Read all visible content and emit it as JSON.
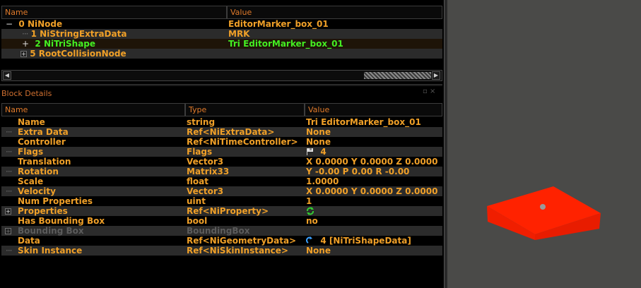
{
  "tree": {
    "col_name": "Name",
    "col_value": "Value",
    "rows": [
      {
        "name": "0 NiNode",
        "value": "EditorMarker_box_01"
      },
      {
        "name": "1 NiStringExtraData",
        "value": "MRK"
      },
      {
        "name": "2 NiTriShape",
        "value": "Tri EditorMarker_box_01"
      },
      {
        "name": "5 RootCollisionNode",
        "value": ""
      }
    ]
  },
  "details": {
    "title": "Block Details",
    "col_name": "Name",
    "col_type": "Type",
    "col_value": "Value",
    "rows": [
      {
        "name": "Name",
        "type": "string",
        "value": "Tri EditorMarker_box_01"
      },
      {
        "name": "Extra Data",
        "type": "Ref<NiExtraData>",
        "value": "None"
      },
      {
        "name": "Controller",
        "type": "Ref<NiTimeController>",
        "value": "None"
      },
      {
        "name": "Flags",
        "type": "Flags",
        "value": "4"
      },
      {
        "name": "Translation",
        "type": "Vector3",
        "value": "X 0.0000 Y 0.0000 Z 0.0000"
      },
      {
        "name": "Rotation",
        "type": "Matrix33",
        "value": "Y -0.00 P 0.00 R -0.00"
      },
      {
        "name": "Scale",
        "type": "float",
        "value": "1.0000"
      },
      {
        "name": "Velocity",
        "type": "Vector3",
        "value": "X 0.0000 Y 0.0000 Z 0.0000"
      },
      {
        "name": "Num Properties",
        "type": "uint",
        "value": "1"
      },
      {
        "name": "Properties",
        "type": "Ref<NiProperty>",
        "value": ""
      },
      {
        "name": "Has Bounding Box",
        "type": "bool",
        "value": "no"
      },
      {
        "name": "Bounding Box",
        "type": "BoundingBox",
        "value": ""
      },
      {
        "name": "Data",
        "type": "Ref<NiGeometryData>",
        "value": "4 [NiTriShapeData]"
      },
      {
        "name": "Skin Instance",
        "type": "Ref<NiSkinInstance>",
        "value": "None"
      }
    ]
  },
  "icons": {
    "flags": "flag-icon",
    "properties": "refresh-icon",
    "data": "link-icon"
  },
  "colors": {
    "text_orange": "#f0a028",
    "text_green": "#44ee22",
    "text_disabled": "#5c5c5c",
    "header_text": "#e07a2a",
    "viewport_bg": "#4a4a48",
    "box_red": "#ff2200"
  }
}
